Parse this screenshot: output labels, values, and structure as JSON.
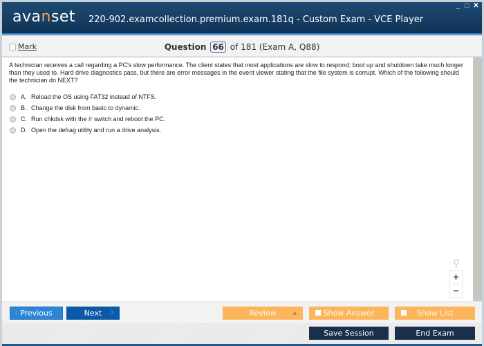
{
  "app": {
    "logo_pre": "ava",
    "logo_accent": "n",
    "logo_post": "set",
    "window_title": "220-902.examcollection.premium.exam.181q - Custom Exam - VCE Player",
    "controls": {
      "minimize": "_",
      "maximize": "□",
      "close": "✕"
    }
  },
  "header": {
    "mark_label": "Mark",
    "question_word": "Question",
    "question_number": "66",
    "question_suffix": "of 181 (Exam A, Q88)"
  },
  "question": {
    "text": "A technician receives a call regarding a PC's slow performance. The client states that most applications are slow to respond; boot up and shutdown take much longer than they used to. Hard drive diagnostics pass, but there are error messages in the event viewer stating that the file system is corrupt. Which of the following should the technician do NEXT?",
    "options": [
      {
        "letter": "A.",
        "text": "Reload the OS using FAT32 instead of NTFS."
      },
      {
        "letter": "B.",
        "text": "Change the disk from basic to dynamic."
      },
      {
        "letter": "C.",
        "text": "Run chkdsk with the /r switch and reboot the PC."
      },
      {
        "letter": "D.",
        "text": "Open the defrag utility and run a drive analysis."
      }
    ]
  },
  "zoom": {
    "magnifier": "⚲",
    "plus": "+",
    "minus": "−"
  },
  "nav": {
    "previous_label": "Previous",
    "next_label": "Next",
    "prev_chevron": "‹",
    "next_chevron": "›",
    "review_label": "Review",
    "review_arrow": "▲",
    "show_answer_label": "Show Answer",
    "show_list_label": "Show List"
  },
  "footer": {
    "save_session_label": "Save Session",
    "end_exam_label": "End Exam"
  },
  "colors": {
    "titlebar": "#173f66",
    "logo_accent": "#f7a935",
    "primary_button": "#0b5aa8",
    "orange_button": "#fdb55c",
    "dark_button": "#18304b"
  }
}
